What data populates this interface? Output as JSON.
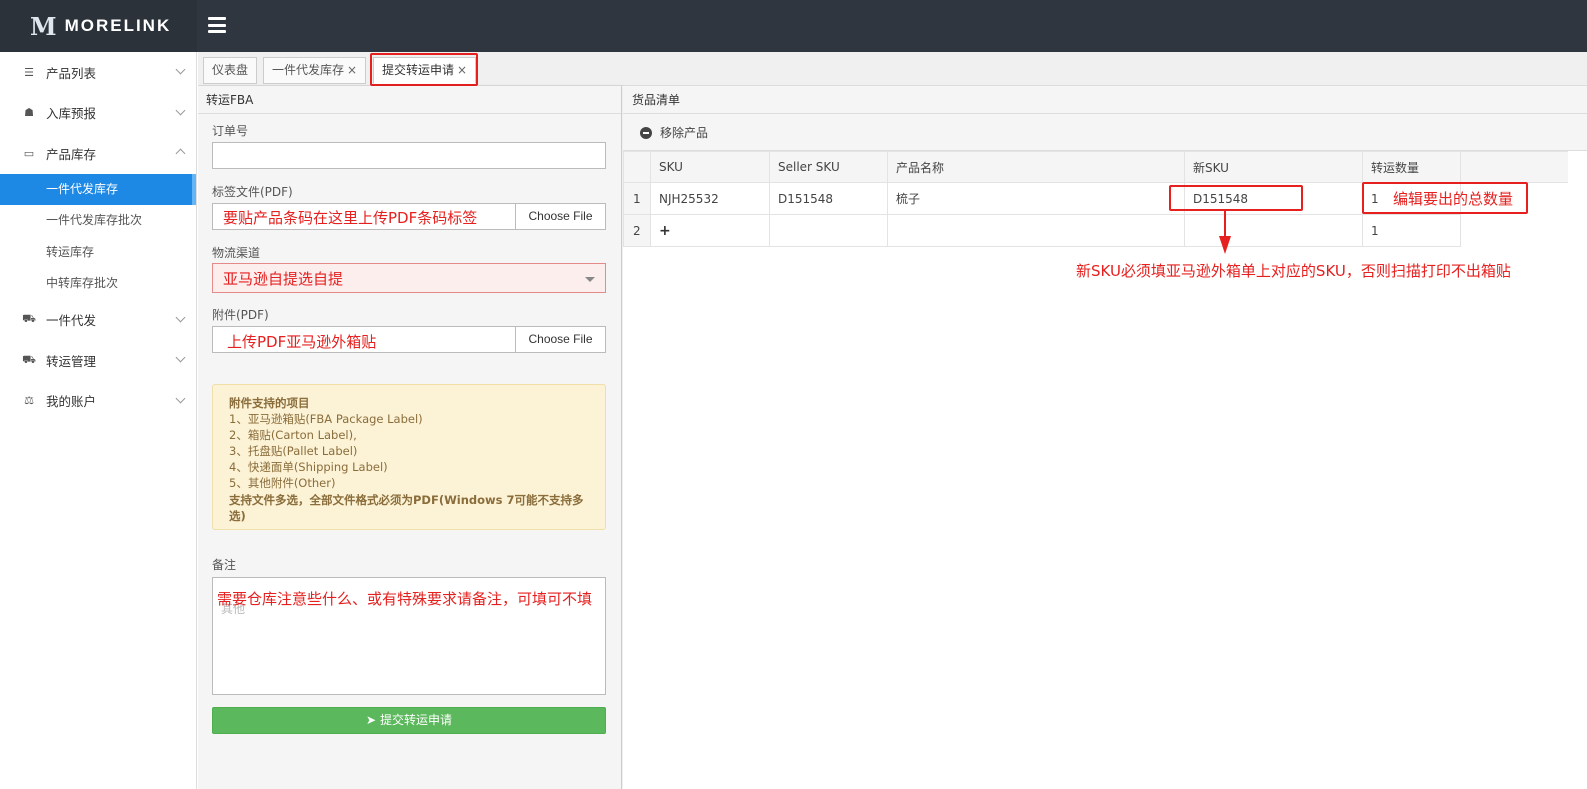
{
  "header": {
    "logo_mark": "M",
    "logo_text": "MORELINK"
  },
  "sidebar": {
    "items": [
      {
        "icon": "list-icon",
        "label": "产品列表",
        "expanded": false
      },
      {
        "icon": "inbox-icon",
        "label": "入库预报",
        "expanded": false
      },
      {
        "icon": "drive-icon",
        "label": "产品库存",
        "expanded": true,
        "children": [
          "一件代发库存",
          "一件代发库存批次",
          "转运库存",
          "中转库存批次"
        ]
      },
      {
        "icon": "truck-icon",
        "label": "一件代发",
        "expanded": false
      },
      {
        "icon": "truck-icon",
        "label": "转运管理",
        "expanded": false
      },
      {
        "icon": "scale-icon",
        "label": "我的账户",
        "expanded": false
      }
    ],
    "active_child": "一件代发库存"
  },
  "tabs": [
    {
      "label": "仪表盘",
      "closable": false
    },
    {
      "label": "一件代发库存",
      "closable": true
    },
    {
      "label": "提交转运申请",
      "closable": true,
      "active": true
    }
  ],
  "form": {
    "title": "转运FBA",
    "order_no_label": "订单号",
    "order_no_value": "",
    "label_file_label": "标签文件(PDF)",
    "label_file_note": "要贴产品条码在这里上传PDF条码标签",
    "choose_file": "Choose File",
    "channel_label": "物流渠道",
    "channel_value": "亚马逊自提选自提",
    "attachment_label": "附件(PDF)",
    "attachment_note": "上传PDF亚马逊外箱贴",
    "info": {
      "title": "附件支持的项目",
      "lines": [
        "1、亚马逊箱贴(FBA Package Label)",
        "2、箱贴(Carton Label),",
        "3、托盘贴(Pallet Label)",
        "4、快递面单(Shipping Label)",
        "5、其他附件(Other)"
      ],
      "footer": "支持文件多选，全部文件格式必须为PDF(Windows 7可能不支持多选)"
    },
    "remark_label": "备注",
    "remark_placeholder": "其他",
    "remark_note": "需要仓库注意些什么、或有特殊要求请备注，可填可不填",
    "submit": "提交转运申请"
  },
  "goods": {
    "title": "货品清单",
    "remove_button": "移除产品",
    "columns": [
      "SKU",
      "Seller SKU",
      "产品名称",
      "新SKU",
      "转运数量"
    ],
    "rows": [
      {
        "no": "1",
        "sku": "NJH25532",
        "seller_sku": "D151548",
        "name": "梳子",
        "new_sku": "D151548",
        "qty": "1"
      },
      {
        "no": "2",
        "sku": "+",
        "seller_sku": "",
        "name": "",
        "new_sku": "",
        "qty": "1"
      }
    ],
    "qty_note": "编辑要出的总数量",
    "new_sku_note": "新SKU必须填亚马逊外箱单上对应的SKU，否则扫描打印不出箱贴"
  },
  "colors": {
    "topbar": "#2f3640",
    "active": "#1e88e5",
    "annotation": "#e5201f",
    "submit": "#5cb85c"
  }
}
